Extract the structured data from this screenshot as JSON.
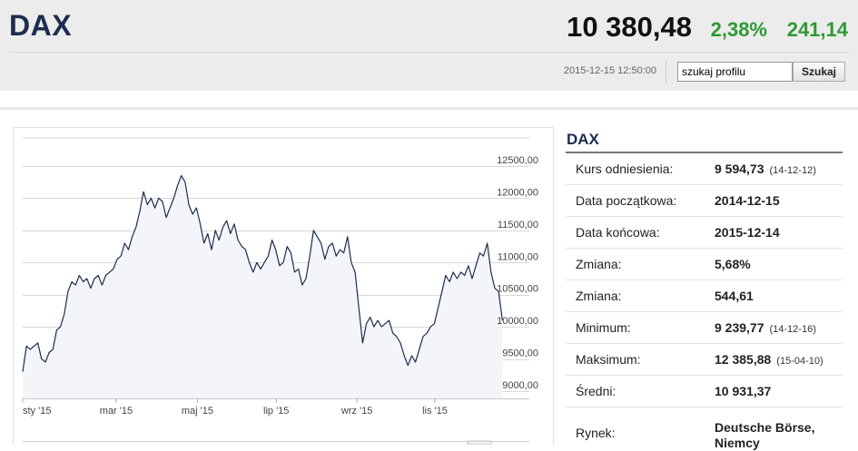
{
  "header": {
    "title": "DAX",
    "price": "10 380,48",
    "change_pct": "2,38%",
    "change_abs": "241,14",
    "timestamp": "2015-12-15 12:50:00",
    "search_value": "szukaj profilu",
    "search_button": "Szukaj"
  },
  "colors": {
    "brand": "#1c2d4f",
    "positive": "#2e9a35",
    "line": "#1c2d4f",
    "area": "#f3f5f8"
  },
  "info": {
    "title": "DAX",
    "rows": [
      {
        "label": "Kurs odniesienia:",
        "value": "9 594,73",
        "date": "(14-12-12)"
      },
      {
        "label": "Data początkowa:",
        "value": "2014-12-15",
        "date": ""
      },
      {
        "label": "Data końcowa:",
        "value": "2015-12-14",
        "date": ""
      },
      {
        "label": "Zmiana:",
        "value": "5,68%",
        "date": ""
      },
      {
        "label": "Zmiana:",
        "value": "544,61",
        "date": ""
      },
      {
        "label": "Minimum:",
        "value": "9 239,77",
        "date": "(14-12-16)"
      },
      {
        "label": "Maksimum:",
        "value": "12 385,88",
        "date": "(15-04-10)"
      },
      {
        "label": "Średni:",
        "value": "10 931,37",
        "date": ""
      },
      {
        "label": "Rynek:",
        "value": "Deutsche Börse, Niemcy",
        "date": ""
      }
    ]
  },
  "chart_data": {
    "type": "area",
    "y_ticks": [
      "12500,00",
      "12000,00",
      "11500,00",
      "11000,00",
      "10500,00",
      "10000,00",
      "9500,00",
      "9000,00"
    ],
    "ylim": [
      9000,
      12600
    ],
    "x_ticks": [
      {
        "label": "sty '15",
        "t": 0.0
      },
      {
        "label": "mar '15",
        "t": 0.198
      },
      {
        "label": "maj '15",
        "t": 0.37
      },
      {
        "label": "lip '15",
        "t": 0.537
      },
      {
        "label": "wrz '15",
        "t": 0.708
      },
      {
        "label": "lis '15",
        "t": 0.873
      }
    ],
    "series": [
      {
        "values": [
          [
            0.0,
            9300
          ],
          [
            0.008,
            9700
          ],
          [
            0.016,
            9650
          ],
          [
            0.024,
            9700
          ],
          [
            0.032,
            9750
          ],
          [
            0.04,
            9500
          ],
          [
            0.048,
            9450
          ],
          [
            0.056,
            9600
          ],
          [
            0.064,
            9650
          ],
          [
            0.072,
            9950
          ],
          [
            0.08,
            10000
          ],
          [
            0.088,
            10200
          ],
          [
            0.096,
            10550
          ],
          [
            0.104,
            10700
          ],
          [
            0.112,
            10650
          ],
          [
            0.12,
            10800
          ],
          [
            0.128,
            10700
          ],
          [
            0.136,
            10750
          ],
          [
            0.144,
            10600
          ],
          [
            0.152,
            10750
          ],
          [
            0.16,
            10800
          ],
          [
            0.168,
            10650
          ],
          [
            0.176,
            10800
          ],
          [
            0.184,
            10850
          ],
          [
            0.192,
            10900
          ],
          [
            0.2,
            11050
          ],
          [
            0.208,
            11100
          ],
          [
            0.216,
            11300
          ],
          [
            0.224,
            11200
          ],
          [
            0.232,
            11400
          ],
          [
            0.24,
            11550
          ],
          [
            0.248,
            11800
          ],
          [
            0.256,
            12100
          ],
          [
            0.264,
            11900
          ],
          [
            0.272,
            12000
          ],
          [
            0.28,
            11850
          ],
          [
            0.288,
            12000
          ],
          [
            0.296,
            11950
          ],
          [
            0.304,
            11700
          ],
          [
            0.312,
            11850
          ],
          [
            0.32,
            12000
          ],
          [
            0.328,
            12200
          ],
          [
            0.336,
            12350
          ],
          [
            0.344,
            12250
          ],
          [
            0.352,
            11900
          ],
          [
            0.36,
            11750
          ],
          [
            0.368,
            11850
          ],
          [
            0.376,
            11600
          ],
          [
            0.384,
            11300
          ],
          [
            0.392,
            11450
          ],
          [
            0.4,
            11200
          ],
          [
            0.408,
            11500
          ],
          [
            0.416,
            11350
          ],
          [
            0.424,
            11550
          ],
          [
            0.432,
            11650
          ],
          [
            0.44,
            11450
          ],
          [
            0.448,
            11600
          ],
          [
            0.456,
            11350
          ],
          [
            0.464,
            11250
          ],
          [
            0.472,
            11200
          ],
          [
            0.48,
            11000
          ],
          [
            0.488,
            10850
          ],
          [
            0.496,
            11000
          ],
          [
            0.504,
            10900
          ],
          [
            0.512,
            11000
          ],
          [
            0.52,
            11100
          ],
          [
            0.528,
            11350
          ],
          [
            0.536,
            11200
          ],
          [
            0.544,
            10950
          ],
          [
            0.552,
            11000
          ],
          [
            0.56,
            11250
          ],
          [
            0.568,
            11150
          ],
          [
            0.576,
            10850
          ],
          [
            0.584,
            10900
          ],
          [
            0.592,
            10650
          ],
          [
            0.6,
            10750
          ],
          [
            0.608,
            11100
          ],
          [
            0.616,
            11500
          ],
          [
            0.624,
            11400
          ],
          [
            0.632,
            11300
          ],
          [
            0.64,
            11050
          ],
          [
            0.648,
            11250
          ],
          [
            0.656,
            11300
          ],
          [
            0.664,
            11100
          ],
          [
            0.672,
            11200
          ],
          [
            0.68,
            11150
          ],
          [
            0.688,
            11400
          ],
          [
            0.696,
            11000
          ],
          [
            0.704,
            10850
          ],
          [
            0.712,
            10300
          ],
          [
            0.72,
            9750
          ],
          [
            0.728,
            10050
          ],
          [
            0.736,
            10150
          ],
          [
            0.744,
            10000
          ],
          [
            0.752,
            10100
          ],
          [
            0.76,
            10000
          ],
          [
            0.768,
            10050
          ],
          [
            0.776,
            10100
          ],
          [
            0.784,
            9900
          ],
          [
            0.792,
            9850
          ],
          [
            0.8,
            9750
          ],
          [
            0.808,
            9550
          ],
          [
            0.816,
            9400
          ],
          [
            0.824,
            9550
          ],
          [
            0.832,
            9450
          ],
          [
            0.84,
            9650
          ],
          [
            0.848,
            9850
          ],
          [
            0.856,
            9900
          ],
          [
            0.864,
            10000
          ],
          [
            0.872,
            10050
          ],
          [
            0.88,
            10300
          ],
          [
            0.888,
            10550
          ],
          [
            0.896,
            10800
          ],
          [
            0.904,
            10700
          ],
          [
            0.912,
            10850
          ],
          [
            0.92,
            10750
          ],
          [
            0.928,
            10850
          ],
          [
            0.936,
            10800
          ],
          [
            0.944,
            10950
          ],
          [
            0.952,
            10750
          ],
          [
            0.96,
            10950
          ],
          [
            0.968,
            11150
          ],
          [
            0.976,
            11100
          ],
          [
            0.984,
            11300
          ],
          [
            0.992,
            10850
          ],
          [
            1.0,
            10600
          ],
          [
            1.008,
            10550
          ],
          [
            1.016,
            10100
          ]
        ]
      }
    ]
  }
}
